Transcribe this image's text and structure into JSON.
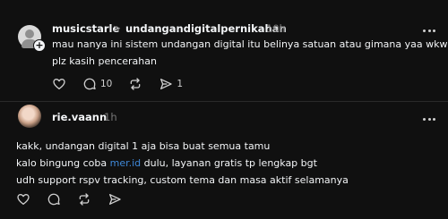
{
  "post1": {
    "username": "musicstarle",
    "separator": ">",
    "community": "undangandigitalpernikahan",
    "timestamp": "10h",
    "lines": [
      "mau nanya ini sistem undangan digital itu belinya satuan atau gimana yaa wkwk",
      "plz kasih pencerahan"
    ],
    "actions": {
      "like_icon": "heart-icon",
      "reply_icon": "comment-icon",
      "reply_count": "10",
      "repost_icon": "repost-icon",
      "share_icon": "send-icon",
      "share_count": "1"
    }
  },
  "post2": {
    "username": "rie.vaann",
    "timestamp": "1h",
    "line1": "kakk, undangan digital 1 aja bisa buat semua tamu",
    "line2_before": "kalo bingung coba ",
    "line2_link": "mer.id",
    "line2_after": " dulu, layanan gratis tp lengkap bgt",
    "line3": "udh support rspv tracking, custom tema dan masa aktif selamanya",
    "actions": {
      "like_icon": "heart-icon",
      "reply_icon": "comment-icon",
      "repost_icon": "repost-icon",
      "share_icon": "send-icon"
    }
  },
  "colors": {
    "background": "#101010",
    "text": "#f3f5f7",
    "muted": "#777777",
    "link": "#3f89d9"
  }
}
